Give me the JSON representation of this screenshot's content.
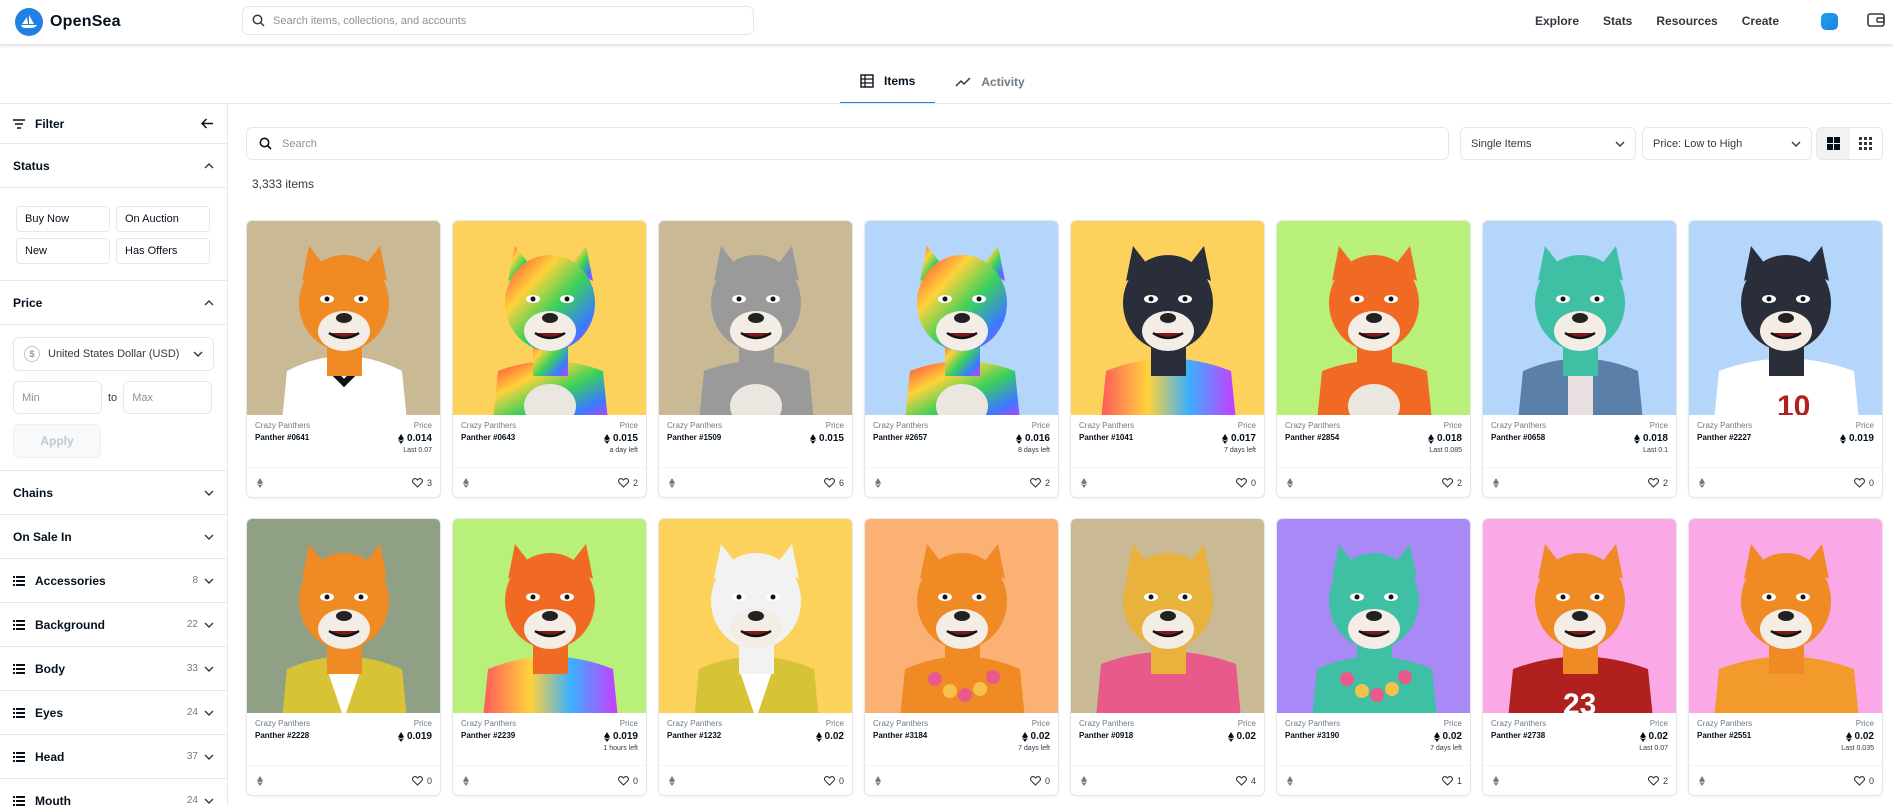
{
  "brand": {
    "name": "OpenSea"
  },
  "nav": {
    "search_placeholder": "Search items, collections, and accounts",
    "links": [
      "Explore",
      "Stats",
      "Resources",
      "Create"
    ]
  },
  "tabs": [
    {
      "label": "Items",
      "active": true
    },
    {
      "label": "Activity",
      "active": false
    }
  ],
  "sidebar": {
    "filter_label": "Filter",
    "status": {
      "label": "Status",
      "options": [
        "Buy Now",
        "On Auction",
        "New",
        "Has Offers"
      ]
    },
    "price": {
      "label": "Price",
      "currency": "United States Dollar (USD)",
      "min_placeholder": "Min",
      "max_placeholder": "Max",
      "to": "to",
      "apply": "Apply"
    },
    "chains": "Chains",
    "on_sale_in": "On Sale In",
    "traits": [
      {
        "label": "Accessories",
        "count": "8"
      },
      {
        "label": "Background",
        "count": "22"
      },
      {
        "label": "Body",
        "count": "33"
      },
      {
        "label": "Eyes",
        "count": "24"
      },
      {
        "label": "Head",
        "count": "37"
      },
      {
        "label": "Mouth",
        "count": "24"
      }
    ]
  },
  "main": {
    "search_placeholder": "Search",
    "single_items": "Single Items",
    "sort": "Price: Low to High",
    "items_count": "3,333 items"
  },
  "colors": {
    "accent": "#2081e2",
    "text": "#04111d"
  },
  "cards": [
    {
      "collection": "Crazy Panthers",
      "name": "Panther #0641",
      "price_label": "Price",
      "price": "0.014",
      "sub": "Last  0.07",
      "likes": "3",
      "bg": "#c9b994",
      "animal": "tiger",
      "fur": "#f08a24",
      "shirt": "tux"
    },
    {
      "collection": "Crazy Panthers",
      "name": "Panther #0643",
      "price_label": "Price",
      "price": "0.015",
      "sub": "a day left",
      "likes": "2",
      "bg": "#fcd25c",
      "animal": "rainbow",
      "fur": "rainbow",
      "shirt": "none"
    },
    {
      "collection": "Crazy Panthers",
      "name": "Panther #1509",
      "price_label": "Price",
      "price": "0.015",
      "sub": "",
      "likes": "6",
      "bg": "#c9b994",
      "animal": "grey",
      "fur": "#9a9a9a",
      "shirt": "none"
    },
    {
      "collection": "Crazy Panthers",
      "name": "Panther #2657",
      "price_label": "Price",
      "price": "0.016",
      "sub": "8 days left",
      "likes": "2",
      "bg": "#b3d6fa",
      "animal": "rainbow",
      "fur": "rainbow",
      "shirt": "none"
    },
    {
      "collection": "Crazy Panthers",
      "name": "Panther #1041",
      "price_label": "Price",
      "price": "0.017",
      "sub": "7 days left",
      "likes": "0",
      "bg": "#fcd25c",
      "animal": "black",
      "fur": "#2a2d3a",
      "shirt": "tiedye"
    },
    {
      "collection": "Crazy Panthers",
      "name": "Panther #2854",
      "price_label": "Price",
      "price": "0.018",
      "sub": "Last  0.085",
      "likes": "2",
      "bg": "#b8f07a",
      "animal": "red",
      "fur": "#f06a24",
      "shirt": "none"
    },
    {
      "collection": "Crazy Panthers",
      "name": "Panther #0658",
      "price_label": "Price",
      "price": "0.018",
      "sub": "Last  0.1",
      "likes": "2",
      "bg": "#b3d6fa",
      "animal": "teal",
      "fur": "#3fbfa4",
      "shirt": "vest"
    },
    {
      "collection": "Crazy Panthers",
      "name": "Panther #2227",
      "price_label": "Price",
      "price": "0.019",
      "sub": "",
      "likes": "0",
      "bg": "#b3d6fa",
      "animal": "black",
      "fur": "#2a2d3a",
      "shirt": "jersey"
    },
    {
      "collection": "Crazy Panthers",
      "name": "Panther #2228",
      "price_label": "Price",
      "price": "0.019",
      "sub": "",
      "likes": "0",
      "bg": "#8fa084",
      "animal": "tiger",
      "fur": "#f08a24",
      "shirt": "fur"
    },
    {
      "collection": "Crazy Panthers",
      "name": "Panther #2239",
      "price_label": "Price",
      "price": "0.019",
      "sub": "1 hours left",
      "likes": "0",
      "bg": "#b8f07a",
      "animal": "red",
      "fur": "#f06a24",
      "shirt": "tiedye"
    },
    {
      "collection": "Crazy Panthers",
      "name": "Panther #1232",
      "price_label": "Price",
      "price": "0.02",
      "sub": "",
      "likes": "0",
      "bg": "#fcd25c",
      "animal": "zebra",
      "fur": "#f2f2f2",
      "shirt": "fur"
    },
    {
      "collection": "Crazy Panthers",
      "name": "Panther #3184",
      "price_label": "Price",
      "price": "0.02",
      "sub": "7 days left",
      "likes": "0",
      "bg": "#fbb173",
      "animal": "tiger",
      "fur": "#f08a24",
      "shirt": "lei"
    },
    {
      "collection": "Crazy Panthers",
      "name": "Panther #0918",
      "price_label": "Price",
      "price": "0.02",
      "sub": "",
      "likes": "4",
      "bg": "#c9b994",
      "animal": "leopard",
      "fur": "#e8b23c",
      "shirt": "hoodie"
    },
    {
      "collection": "Crazy Panthers",
      "name": "Panther #3190",
      "price_label": "Price",
      "price": "0.02",
      "sub": "7 days left",
      "likes": "1",
      "bg": "#a989f5",
      "animal": "teal",
      "fur": "#3fbfa4",
      "shirt": "lei"
    },
    {
      "collection": "Crazy Panthers",
      "name": "Panther #2738",
      "price_label": "Price",
      "price": "0.02",
      "sub": "Last  0.07",
      "likes": "2",
      "bg": "#fba9e6",
      "animal": "tiger",
      "fur": "#f08a24",
      "shirt": "jersey23"
    },
    {
      "collection": "Crazy Panthers",
      "name": "Panther #2551",
      "price_label": "Price",
      "price": "0.02",
      "sub": "Last  0.035",
      "likes": "0",
      "bg": "#fba9e6",
      "animal": "tiger",
      "fur": "#f08a24",
      "shirt": "orange"
    }
  ]
}
